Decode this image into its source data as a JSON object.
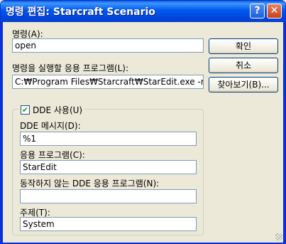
{
  "window": {
    "title": "명령 편집: Starcraft Scenario",
    "help_glyph": "?",
    "close_glyph": "✕"
  },
  "command": {
    "label": "명령(A):",
    "value": "open"
  },
  "app": {
    "label": "명령을 실행할 응용 프로그램(L):",
    "value": "C:₩Program Files₩Starcraft₩StarEdit.exe -n"
  },
  "buttons": {
    "ok": "확인",
    "cancel": "취소",
    "browse": "찾아보기(B)..."
  },
  "dde": {
    "checkbox_label": "DDE 사용(U)",
    "checked": true,
    "message_label": "DDE 메시지(D):",
    "message_value": "%1",
    "application_label": "응용 프로그램(C):",
    "application_value": "StarEdit",
    "not_running_label": "동작하지 않는 DDE 응용 프로그램(N):",
    "not_running_value": "",
    "topic_label": "주제(T):",
    "topic_value": "System"
  }
}
